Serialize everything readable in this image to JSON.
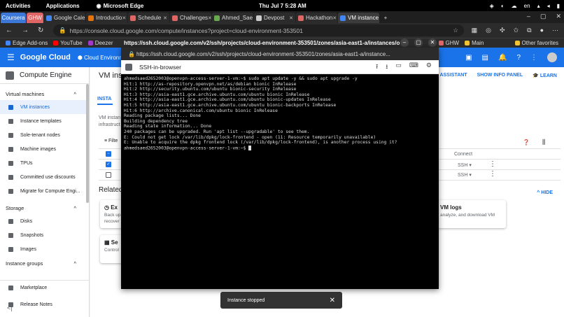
{
  "topbar": {
    "activities": "Activities",
    "applications": "Applications",
    "app_name": "Microsoft Edge",
    "clock": "Thu Jul 7  5:28 AM",
    "lang": "en"
  },
  "tabs": [
    {
      "label": "Coursera",
      "pinned": true
    },
    {
      "label": "GHW",
      "pinned": true
    },
    {
      "label": "Google Cale"
    },
    {
      "label": "Introductio"
    },
    {
      "label": "Schedule"
    },
    {
      "label": "Challenges"
    },
    {
      "label": "Ahmed_Sae"
    },
    {
      "label": "Devpost"
    },
    {
      "label": "Hackathon"
    },
    {
      "label": "VM instance"
    }
  ],
  "address": {
    "url": "https://console.cloud.google.com/compute/instances?project=cloud-environment-353501"
  },
  "bookmarks": [
    {
      "label": "Edge Add-ons"
    },
    {
      "label": "YouTube"
    },
    {
      "label": "Deezer"
    },
    {
      "label": "GHW"
    },
    {
      "label": "Main"
    },
    {
      "label": "Other favorites"
    }
  ],
  "gc_header": {
    "brand": "Google Cloud",
    "project": "Cloud Environment"
  },
  "leftnav": {
    "title": "Compute Engine",
    "section_vm": "Virtual machines",
    "vm_items": [
      "VM instances",
      "Instance templates",
      "Sole-tenant nodes",
      "Machine images",
      "TPUs",
      "Committed use discounts",
      "Migrate for Compute Engi..."
    ],
    "section_storage": "Storage",
    "storage_items": [
      "Disks",
      "Snapshots",
      "Images"
    ],
    "section_groups": "Instance groups",
    "bottom_items": [
      "Marketplace",
      "Release Notes"
    ]
  },
  "main": {
    "title": "VM inst",
    "help_assistant": "LP ASSISTANT",
    "show_info": "SHOW INFO PANEL",
    "learn": "LEARN",
    "tab": "INSTA",
    "desc": "VM instan infrastruct",
    "filter": "Filte",
    "connect_header": "Connect",
    "ssh": "SSH",
    "related": "Related",
    "hide": "HIDE",
    "card1_title": "Ex",
    "card1_sub": "Back up recover",
    "card2_title": "VM logs",
    "card2_sub": "analyze, and download VM",
    "card3_title": "Se",
    "card3_sub": "Control"
  },
  "ssh_window": {
    "outer_url": "https://ssh.cloud.google.com/v2/ssh/projects/cloud-environment-353501/zones/asia-east1-a/instances/openvpn...",
    "inner_url": "https://ssh.cloud.google.com/v2/ssh/projects/cloud-environment-353501/zones/asia-east1-a/instance...",
    "title": "SSH-in-browser"
  },
  "terminal": {
    "lines": [
      "ahmedsaed2652003@openvpn-access-server-1-vm:~$ sudo apt update -y && sudo apt upgrade -y",
      "Hit:1 http://as-repository.openvpn.net/as/debian bionic InRelease",
      "Hit:2 http://security.ubuntu.com/ubuntu bionic-security InRelease",
      "Hit:3 http://asia-east1.gce.archive.ubuntu.com/ubuntu bionic InRelease",
      "Hit:4 http://asia-east1.gce.archive.ubuntu.com/ubuntu bionic-updates InRelease",
      "Hit:5 http://asia-east1.gce.archive.ubuntu.com/ubuntu bionic-backports InRelease",
      "Hit:6 http://archive.canonical.com/ubuntu bionic InRelease",
      "Reading package lists... Done",
      "Building dependency tree",
      "Reading state information... Done",
      "240 packages can be upgraded. Run 'apt list --upgradable' to see them.",
      "E: Could not get lock /var/lib/dpkg/lock-frontend - open (11: Resource temporarily unavailable)",
      "E: Unable to acquire the dpkg frontend lock (/var/lib/dpkg/lock-frontend), is another process using it?"
    ],
    "prompt": "ahmedsaed2652003@openvpn-access-server-1-vm:~$ "
  },
  "toast": {
    "message": "Instance stopped"
  },
  "colors": {
    "gc_blue": "#1a73e8",
    "terminal_bg": "#000000"
  }
}
